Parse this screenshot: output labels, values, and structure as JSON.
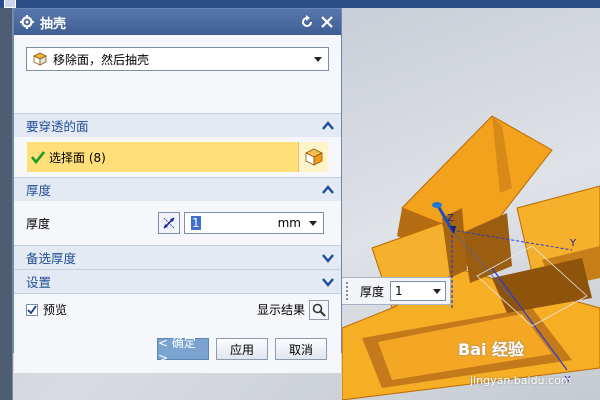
{
  "dialog": {
    "title": "抽壳",
    "type_select": "移除面，然后抽壳",
    "faces_group": {
      "header": "要穿透的面",
      "select_label": "选择面 (8)"
    },
    "thickness_group": {
      "header": "厚度",
      "label": "厚度",
      "value": "1",
      "unit": "mm"
    },
    "alt_thickness_header": "备选厚度",
    "settings_header": "设置",
    "preview_label": "预览",
    "preview_checked": true,
    "show_result_label": "显示结果",
    "buttons": {
      "ok": "< 确定 >",
      "apply": "应用",
      "cancel": "取消"
    }
  },
  "floating_tool": {
    "label": "厚度",
    "value": "1"
  },
  "viewport": {
    "axes": {
      "z": "Z",
      "y": "Y",
      "x": "X"
    },
    "watermark": "Bai 经验",
    "watermark_sub": "jingyan.baidu.com"
  },
  "colors": {
    "title_bar": "#4a6aa2",
    "header_text": "#1f4e96",
    "selected_row": "#ffdf77",
    "model_orange": "#f5a623"
  }
}
